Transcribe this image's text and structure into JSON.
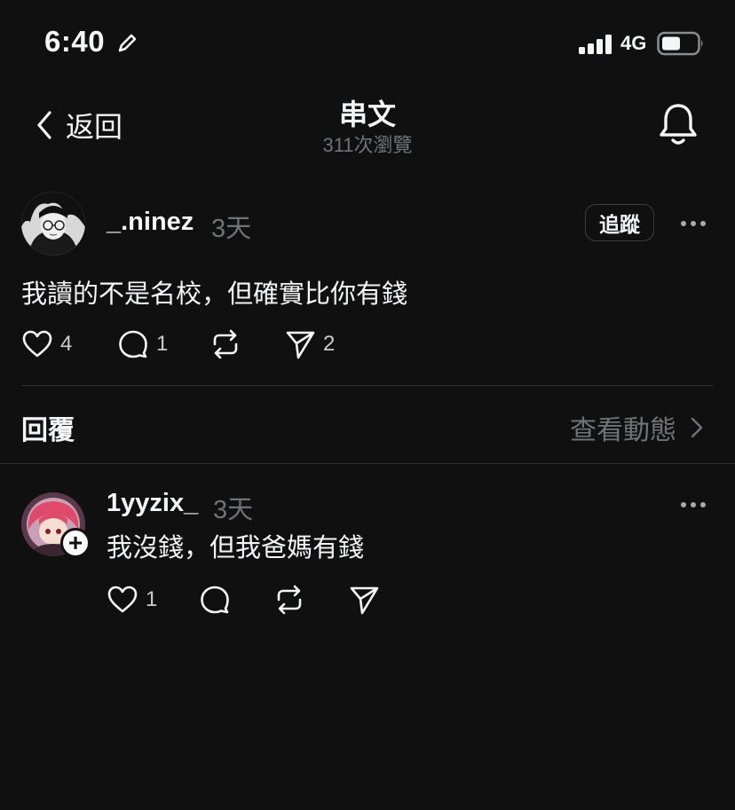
{
  "status_bar": {
    "time": "6:40",
    "network": "4G"
  },
  "nav": {
    "back_label": "返回",
    "title": "串文",
    "subtitle": "311次瀏覽"
  },
  "post": {
    "username": "_.ninez",
    "time_ago": "3天",
    "follow_label": "追蹤",
    "text": "我讀的不是名校，但確實比你有錢",
    "likes": "4",
    "comments": "1",
    "shares": "2"
  },
  "replies_section": {
    "label": "回覆",
    "activity_label": "查看動態"
  },
  "reply": {
    "username": "1yyzix_",
    "time_ago": "3天",
    "text": "我沒錢，但我爸媽有錢",
    "likes": "1"
  },
  "colors": {
    "background": "#101010",
    "text": "#f3f5f7",
    "muted": "#6f7378"
  }
}
